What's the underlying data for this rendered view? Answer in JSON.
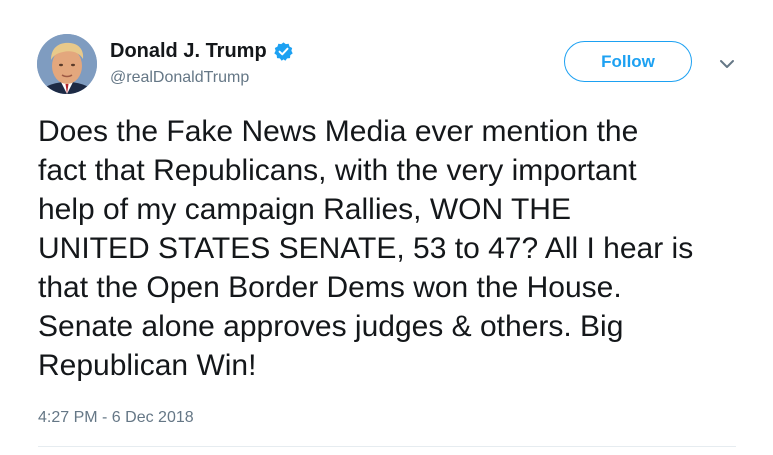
{
  "tweet": {
    "author": {
      "display_name": "Donald J. Trump",
      "handle": "@realDonaldTrump",
      "verified_icon": "verified-badge-icon",
      "avatar_icon": "profile-photo"
    },
    "follow_label": "Follow",
    "menu_icon": "chevron-down-icon",
    "text_lines": [
      "Does the Fake News Media ever mention the",
      "fact that Republicans, with the very important",
      "help of my campaign Rallies, WON THE",
      "UNITED STATES SENATE, 53 to 47? All I hear is",
      "that the Open Border Dems won the House.",
      "Senate alone approves judges & others. Big",
      "Republican Win!"
    ],
    "timestamp": "4:27 PM - 6 Dec 2018"
  },
  "colors": {
    "accent": "#1da1f2",
    "text": "#14171a",
    "secondary_text": "#657786",
    "divider": "#e6ecf0"
  }
}
